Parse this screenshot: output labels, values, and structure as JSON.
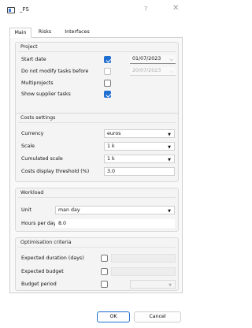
{
  "window": {
    "title": "_FS",
    "help_glyph": "?",
    "close_glyph": "✕"
  },
  "tabs": [
    {
      "label": "Main",
      "active": true
    },
    {
      "label": "Risks",
      "active": false
    },
    {
      "label": "Interfaces",
      "active": false
    }
  ],
  "project": {
    "title": "Project",
    "start_date": {
      "label": "Start date",
      "checked": true,
      "value": "01/07/2023"
    },
    "no_modify": {
      "label": "Do not modify tasks before",
      "checked": false,
      "value": "20/07/2023"
    },
    "multiprojects": {
      "label": "Multiprojects",
      "checked": false
    },
    "show_supplier": {
      "label": "Show supplier tasks",
      "checked": true
    }
  },
  "costs": {
    "title": "Costs settings",
    "currency": {
      "label": "Currency",
      "value": "euros"
    },
    "scale": {
      "label": "Scale",
      "value": "1 k"
    },
    "cumulated_scale": {
      "label": "Cumulated scale",
      "value": "1 k"
    },
    "threshold": {
      "label": "Costs display threshold (%)",
      "value": "3.0"
    }
  },
  "workload": {
    "title": "Workload",
    "unit": {
      "label": "Unit",
      "value": "man day"
    },
    "hours_per_day": {
      "label": "Hours per day",
      "value": "8.0"
    }
  },
  "optimisation": {
    "title": "Optimisation criteria",
    "expected_duration": {
      "label": "Expected duration (days)",
      "checked": false,
      "value": ""
    },
    "expected_budget": {
      "label": "Expected budget",
      "checked": false,
      "value": ""
    },
    "budget_period": {
      "label": "Budget period",
      "checked": false,
      "value": ""
    }
  },
  "buttons": {
    "ok": "OK",
    "cancel": "Cancel"
  },
  "colors": {
    "accent": "#1f6fd1",
    "panel": "#f9f9f9",
    "group": "#f4f4f4"
  }
}
